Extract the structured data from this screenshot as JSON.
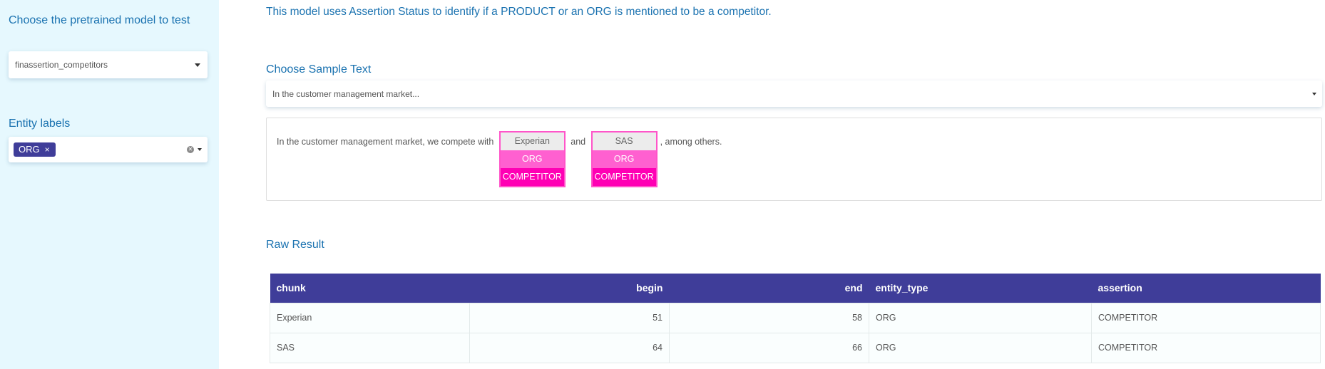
{
  "sidebar": {
    "model_title": "Choose the pretrained model to test",
    "model_value": "finassertion_competitors",
    "entity_title": "Entity labels",
    "entity_chips": [
      "ORG"
    ],
    "chip_remove": "×"
  },
  "main": {
    "description": "This model uses Assertion Status to identify if a PRODUCT or an ORG is mentioned to be a competitor.",
    "sample_title": "Choose Sample Text",
    "sample_value": "In the customer management market...",
    "sentence": {
      "part1": "In the customer management market, we compete with ",
      "entity1": {
        "word": "Experian",
        "label": "ORG",
        "assertion": "COMPETITOR"
      },
      "part2": " and ",
      "entity2": {
        "word": "SAS",
        "label": "ORG",
        "assertion": "COMPETITOR"
      },
      "part3": ", among others."
    },
    "raw_title": "Raw Result",
    "table": {
      "headers": [
        "chunk",
        "begin",
        "end",
        "entity_type",
        "assertion"
      ],
      "rows": [
        [
          "Experian",
          "51",
          "58",
          "ORG",
          "COMPETITOR"
        ],
        [
          "SAS",
          "64",
          "66",
          "ORG",
          "COMPETITOR"
        ]
      ]
    }
  },
  "icons": {
    "dropdown": "chevron-down-icon",
    "clear": "clear-icon"
  },
  "colors": {
    "sidebar_bg": "#e6f8fe",
    "accent_text": "#1a72b0",
    "chip_bg": "#3f3d99",
    "table_header_bg": "#3f3d99",
    "entity_label": "#ff60d0",
    "entity_assertion": "#ff00b4"
  }
}
